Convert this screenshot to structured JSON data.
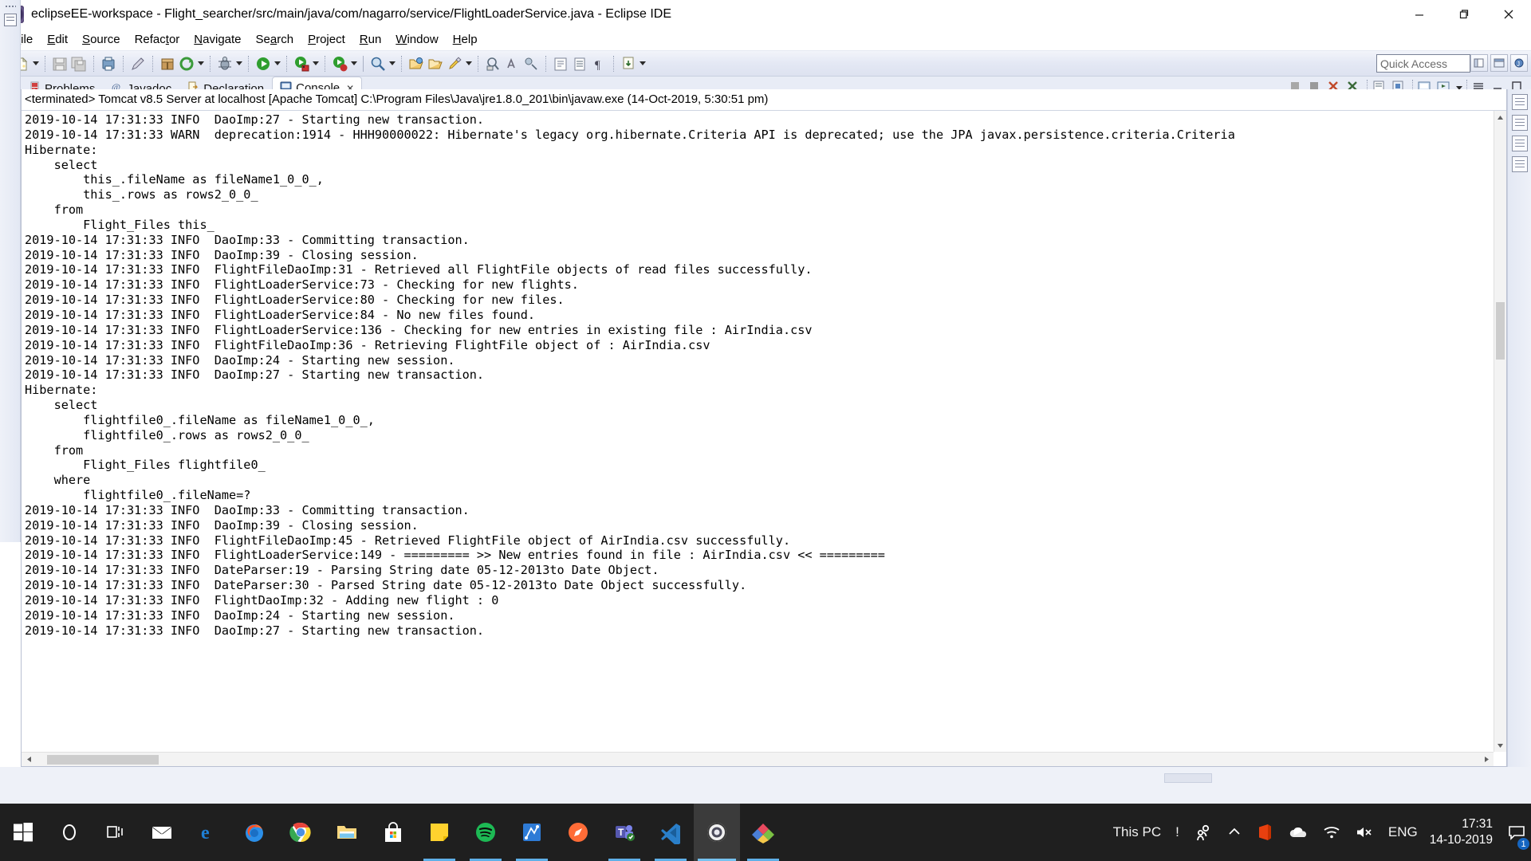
{
  "window": {
    "title": "eclipseEE-workspace - Flight_searcher/src/main/java/com/nagarro/service/FlightLoaderService.java - Eclipse IDE",
    "minimize_label": "Minimize",
    "restore_label": "Restore",
    "close_label": "Close"
  },
  "menu": {
    "items": [
      {
        "label": "File",
        "mnemonic": "F"
      },
      {
        "label": "Edit",
        "mnemonic": "E"
      },
      {
        "label": "Source",
        "mnemonic": "S"
      },
      {
        "label": "Refactor",
        "mnemonic": "t"
      },
      {
        "label": "Navigate",
        "mnemonic": "N"
      },
      {
        "label": "Search",
        "mnemonic": "a"
      },
      {
        "label": "Project",
        "mnemonic": "P"
      },
      {
        "label": "Run",
        "mnemonic": "R"
      },
      {
        "label": "Window",
        "mnemonic": "W"
      },
      {
        "label": "Help",
        "mnemonic": "H"
      }
    ]
  },
  "toolbar": {
    "quick_access_placeholder": "Quick Access",
    "quick_access_value": ""
  },
  "view_tabs": [
    {
      "label": "Problems",
      "icon": "problems-icon",
      "active": false
    },
    {
      "label": "Javadoc",
      "icon": "javadoc-icon",
      "active": false
    },
    {
      "label": "Declaration",
      "icon": "declaration-icon",
      "active": false
    },
    {
      "label": "Console",
      "icon": "console-icon",
      "active": true,
      "closeable": true
    }
  ],
  "console": {
    "header": "<terminated> Tomcat v8.5 Server at localhost [Apache Tomcat] C:\\Program Files\\Java\\jre1.8.0_201\\bin\\javaw.exe (14-Oct-2019, 5:30:51 pm)",
    "lines": [
      "2019-10-14 17:31:33 INFO  DaoImp:27 - Starting new transaction.",
      "2019-10-14 17:31:33 WARN  deprecation:1914 - HHH90000022: Hibernate's legacy org.hibernate.Criteria API is deprecated; use the JPA javax.persistence.criteria.Criteria",
      "Hibernate: ",
      "    select",
      "        this_.fileName as fileName1_0_0_,",
      "        this_.rows as rows2_0_0_",
      "    from",
      "        Flight_Files this_",
      "2019-10-14 17:31:33 INFO  DaoImp:33 - Committing transaction.",
      "2019-10-14 17:31:33 INFO  DaoImp:39 - Closing session.",
      "2019-10-14 17:31:33 INFO  FlightFileDaoImp:31 - Retrieved all FlightFile objects of read files successfully.",
      "2019-10-14 17:31:33 INFO  FlightLoaderService:73 - Checking for new flights.",
      "2019-10-14 17:31:33 INFO  FlightLoaderService:80 - Checking for new files.",
      "2019-10-14 17:31:33 INFO  FlightLoaderService:84 - No new files found.",
      "2019-10-14 17:31:33 INFO  FlightLoaderService:136 - Checking for new entries in existing file : AirIndia.csv",
      "2019-10-14 17:31:33 INFO  FlightFileDaoImp:36 - Retrieving FlightFile object of : AirIndia.csv",
      "2019-10-14 17:31:33 INFO  DaoImp:24 - Starting new session.",
      "2019-10-14 17:31:33 INFO  DaoImp:27 - Starting new transaction.",
      "Hibernate: ",
      "    select",
      "        flightfile0_.fileName as fileName1_0_0_,",
      "        flightfile0_.rows as rows2_0_0_",
      "    from",
      "        Flight_Files flightfile0_",
      "    where",
      "        flightfile0_.fileName=?",
      "2019-10-14 17:31:33 INFO  DaoImp:33 - Committing transaction.",
      "2019-10-14 17:31:33 INFO  DaoImp:39 - Closing session.",
      "2019-10-14 17:31:33 INFO  FlightFileDaoImp:45 - Retrieved FlightFile object of AirIndia.csv successfully.",
      "2019-10-14 17:31:33 INFO  FlightLoaderService:149 - ========= >> New entries found in file : AirIndia.csv << =========",
      "2019-10-14 17:31:33 INFO  DateParser:19 - Parsing String date 05-12-2013to Date Object.",
      "2019-10-14 17:31:33 INFO  DateParser:30 - Parsed String date 05-12-2013to Date Object successfully.",
      "2019-10-14 17:31:33 INFO  FlightDaoImp:32 - Adding new flight : 0",
      "2019-10-14 17:31:33 INFO  DaoImp:24 - Starting new session.",
      "2019-10-14 17:31:33 INFO  DaoImp:27 - Starting new transaction."
    ]
  },
  "taskbar": {
    "start_label": "Start",
    "apps": [
      {
        "name": "start-button",
        "icon": "windows-logo-icon"
      },
      {
        "name": "cortana-search",
        "icon": "cortana-circle-icon"
      },
      {
        "name": "task-view",
        "icon": "task-view-icon"
      },
      {
        "name": "mail",
        "icon": "mail-icon"
      },
      {
        "name": "edge",
        "icon": "edge-icon"
      },
      {
        "name": "firefox",
        "icon": "firefox-icon"
      },
      {
        "name": "chrome",
        "icon": "chrome-icon"
      },
      {
        "name": "file-explorer",
        "icon": "folder-icon"
      },
      {
        "name": "microsoft-store",
        "icon": "store-bag-icon"
      },
      {
        "name": "sticky-notes",
        "icon": "notes-icon"
      },
      {
        "name": "spotify",
        "icon": "spotify-icon"
      },
      {
        "name": "xmind",
        "icon": "xmind-icon"
      },
      {
        "name": "postman",
        "icon": "postman-icon"
      },
      {
        "name": "microsoft-teams",
        "icon": "teams-icon"
      },
      {
        "name": "visual-studio-code",
        "icon": "vscode-icon"
      },
      {
        "name": "eclipse",
        "icon": "eclipse-icon"
      },
      {
        "name": "mysql-workbench",
        "icon": "workbench-icon"
      }
    ],
    "this_pc_label": "This PC",
    "overflow_label": "!",
    "tray": {
      "people_icon": "people-icon",
      "show_hidden_icon": "chevron-up-icon",
      "office_icon": "office-icon",
      "onedrive_icon": "onedrive-cloud-icon",
      "network_icon": "wifi-icon",
      "volume_icon": "speaker-mute-icon",
      "language": "ENG",
      "time": "17:31",
      "date": "14-10-2019",
      "notification_count": "1"
    }
  }
}
